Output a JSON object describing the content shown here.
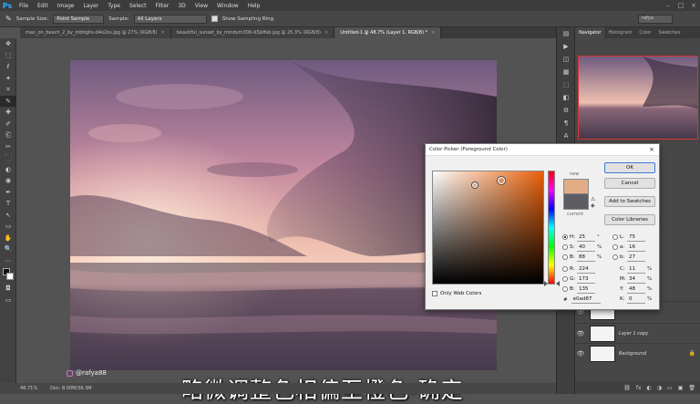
{
  "app": {
    "logo": "Ps"
  },
  "menu": [
    "File",
    "Edit",
    "Image",
    "Layer",
    "Type",
    "Select",
    "Filter",
    "3D",
    "View",
    "Window",
    "Help"
  ],
  "window_controls": [
    "–",
    "□",
    "×"
  ],
  "options": {
    "sample_size_label": "Sample Size:",
    "sample_size_value": "Point Sample",
    "sample_label": "Sample:",
    "sample_value": "All Layers",
    "show_ring_label": "Show Sampling Ring",
    "search_value": "rafya"
  },
  "doc_tabs": [
    {
      "label": "man_on_beach_2_by_mbtighs-d4o2ov.jpg @ 27% (RGB/8)"
    },
    {
      "label": "beautiful_sunset_by_mindym306-d3jk8sb.jpg @ 25.3% (RGB/8)"
    },
    {
      "label": "Untitled-1 @ 48.7% (Layer 1, RGB/8) *"
    }
  ],
  "tools": [
    "✥",
    "⬚",
    "ℓ",
    "✦",
    "⌗",
    "✎",
    "✚",
    "✐",
    "⎗",
    "✂",
    "⬛",
    "◐",
    "◉",
    "✒",
    "T",
    "↖",
    "▭",
    "✋",
    "🔍",
    "⋯"
  ],
  "status": {
    "zoom": "48.71%",
    "doc": "Doc: 8.00M/36.3M"
  },
  "panel_tabs": [
    "Navigator",
    "Histogram",
    "Color",
    "Swatches"
  ],
  "dock_icons": [
    "▤",
    "▶",
    "◫",
    "▦",
    "⬚",
    "◧",
    "⚙",
    "¶",
    "A",
    "≡"
  ],
  "layers": [
    {
      "name": "",
      "thumb": "white"
    },
    {
      "name": "Layer 1 copy",
      "thumb": "white"
    },
    {
      "name": "Background",
      "thumb": "white",
      "locked": true
    }
  ],
  "panel_bottom_icons": [
    "⛓",
    "fx",
    "◐",
    "◑",
    "▭",
    "▣",
    "🗑"
  ],
  "overlay": {
    "watermark": "@rafya88",
    "subtitle": "略微调整色相偏至橙色-确定"
  },
  "dialog": {
    "title": "Color Picker (Foreground Color)",
    "close": "×",
    "new_label": "new",
    "current_label": "current",
    "new_color": "#e0ad87",
    "current_color": "#5d5e64",
    "buttons": {
      "ok": "OK",
      "cancel": "Cancel",
      "add_swatches": "Add to Swatches",
      "libraries": "Color Libraries"
    },
    "hsb": [
      {
        "label": "H:",
        "value": "25",
        "unit": "°",
        "selected": true
      },
      {
        "label": "S:",
        "value": "40",
        "unit": "%"
      },
      {
        "label": "B:",
        "value": "88",
        "unit": "%"
      }
    ],
    "rgb": [
      {
        "label": "R:",
        "value": "224"
      },
      {
        "label": "G:",
        "value": "173"
      },
      {
        "label": "B:",
        "value": "135"
      }
    ],
    "lab": [
      {
        "label": "L:",
        "value": "75"
      },
      {
        "label": "a:",
        "value": "16"
      },
      {
        "label": "b:",
        "value": "27"
      }
    ],
    "cmyk": [
      {
        "label": "C:",
        "value": "11",
        "unit": "%"
      },
      {
        "label": "M:",
        "value": "34",
        "unit": "%"
      },
      {
        "label": "Y:",
        "value": "48",
        "unit": "%"
      },
      {
        "label": "K:",
        "value": "0",
        "unit": "%"
      }
    ],
    "only_web_colors": "Only Web Colors",
    "hex_label": "#",
    "hex_value": "e0ad87"
  }
}
